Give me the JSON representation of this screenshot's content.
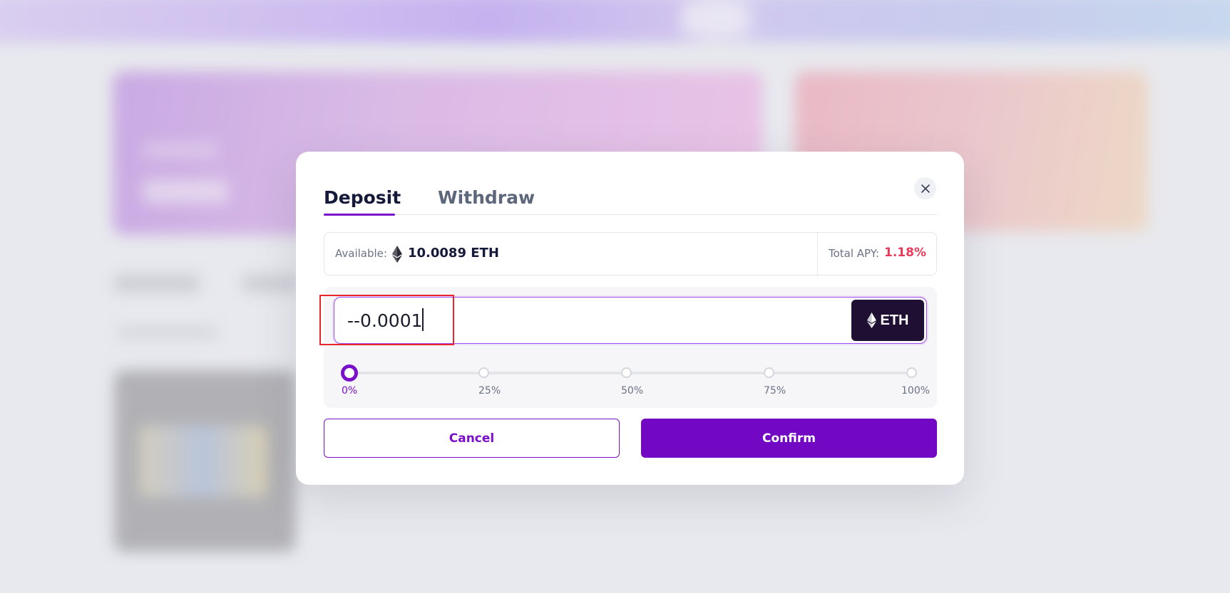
{
  "modal": {
    "tabs": [
      {
        "label": "Deposit",
        "active": true
      },
      {
        "label": "Withdraw",
        "active": false
      }
    ],
    "close_icon": "close-icon",
    "available": {
      "label": "Available:",
      "icon": "eth-icon",
      "value": "10.0089 ETH"
    },
    "apy": {
      "label": "Total APY:",
      "value": "1.18%",
      "color": "#e8395a"
    },
    "amount_input": {
      "value": "--0.0001",
      "placeholder": ""
    },
    "token": {
      "icon": "eth-icon",
      "label": "ETH"
    },
    "slider": {
      "value_percent": 0,
      "stops": [
        "0%",
        "25%",
        "50%",
        "75%",
        "100%"
      ]
    },
    "cancel_label": "Cancel",
    "confirm_label": "Confirm"
  },
  "colors": {
    "accent": "#7a10c9",
    "confirm_bg": "#7207c4",
    "token_bg": "#1f0f33",
    "highlight": "#e8242c"
  }
}
